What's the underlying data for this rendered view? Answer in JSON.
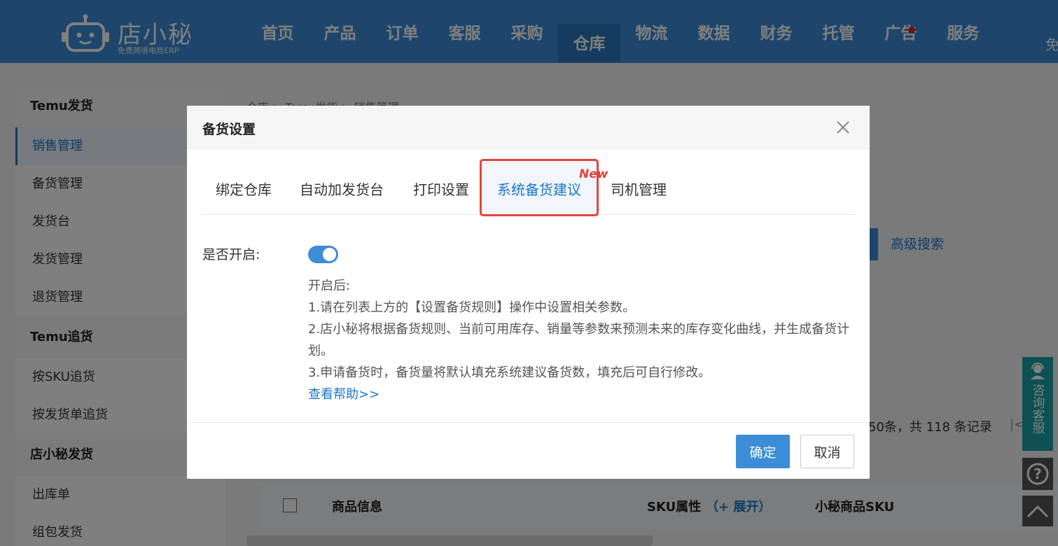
{
  "header": {
    "logo": {
      "name": "店小秘",
      "subtitle": "免费跨境电商ERP"
    },
    "nav": [
      {
        "label": "首页"
      },
      {
        "label": "产品"
      },
      {
        "label": "订单"
      },
      {
        "label": "客服"
      },
      {
        "label": "采购"
      },
      {
        "label": "仓库",
        "active": true
      },
      {
        "label": "物流"
      },
      {
        "label": "数据"
      },
      {
        "label": "财务"
      },
      {
        "label": "托管"
      },
      {
        "label": "广告",
        "badge_dot": true
      },
      {
        "label": "服务"
      }
    ],
    "right_text": "免"
  },
  "sidebar": {
    "groups": [
      {
        "title": "Temu发货",
        "items": [
          "销售管理",
          "备货管理",
          "发货台",
          "发货管理",
          "退货管理"
        ],
        "active_item": "销售管理"
      },
      {
        "title": "Temu追货",
        "items": [
          "按SKU追货",
          "按发货单追货"
        ]
      },
      {
        "title": "店小秘发货",
        "items": [
          "出库单",
          "组包发货"
        ]
      }
    ]
  },
  "main": {
    "breadcrumb": "仓库 > Temu发货 > 销售管理",
    "advanced_search": "高级搜索",
    "records_text": "50条，共 118 条记录",
    "first_page_glyph": "|<",
    "table_headers": {
      "product_info": "商品信息",
      "sku_attr": "SKU属性",
      "sku_expand": "（+ 展开）",
      "xm_sku": "小秘商品SKU"
    }
  },
  "floating": {
    "consult": "咨询客服",
    "help": "?"
  },
  "modal": {
    "title": "备货设置",
    "tabs": [
      {
        "label": "绑定仓库"
      },
      {
        "label": "自动加发货台"
      },
      {
        "label": "打印设置"
      },
      {
        "label": "系统备货建议",
        "active": true,
        "badge": "New"
      },
      {
        "label": "司机管理"
      }
    ],
    "enable_label": "是否开启:",
    "enabled": true,
    "description": {
      "intro": "开启后:",
      "line1": "1.请在列表上方的【设置备货规则】操作中设置相关参数。",
      "line2": "2.店小秘将根据备货规则、当前可用库存、销量等参数来预测未来的库存变化曲线，并生成备货计划。",
      "line3": "3.申请备货时，备货量将默认填充系统建议备货数，填充后可自行修改。",
      "help_link": "查看帮助>>"
    },
    "buttons": {
      "ok": "确定",
      "cancel": "取消"
    }
  },
  "colors": {
    "primary": "#3c8dd8",
    "link": "#1a78cc",
    "highlight": "#e8433a",
    "consult": "#1aa0a6"
  }
}
